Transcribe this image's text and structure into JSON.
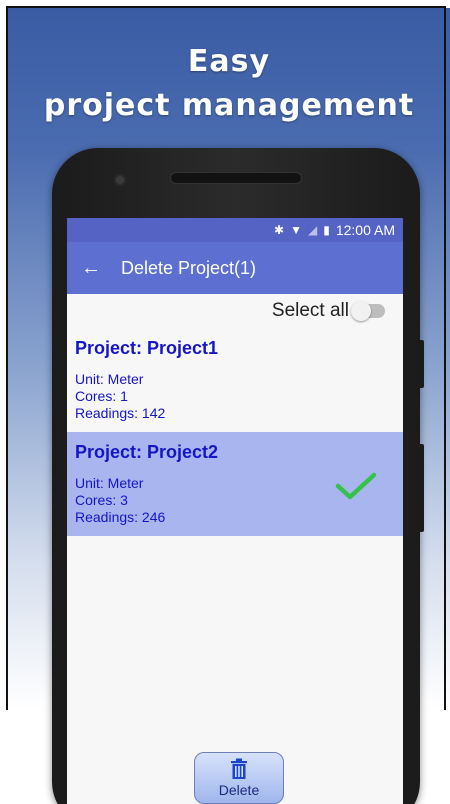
{
  "promo": {
    "line1": "Easy",
    "line2": "project management"
  },
  "statusbar": {
    "time": "12:00 AM",
    "icons": [
      "bluetooth-icon",
      "wifi-icon",
      "signal-icon",
      "battery-icon"
    ]
  },
  "appbar": {
    "title": "Delete Project(1)",
    "back_icon": "arrow-left-icon"
  },
  "select_all": {
    "label": "Select all",
    "checked": false
  },
  "projects": [
    {
      "name": "Project: Project1",
      "unit": "Unit: Meter",
      "cores": "Cores: 1",
      "readings": "Readings: 142",
      "selected": false
    },
    {
      "name": "Project: Project2",
      "unit": "Unit: Meter",
      "cores": "Cores: 3",
      "readings": "Readings: 246",
      "selected": true
    }
  ],
  "delete_button": {
    "label": "Delete",
    "icon": "trash-icon"
  },
  "colors": {
    "statusbar": "#5563c4",
    "appbar": "#5d6fd0",
    "selected_row": "#a9b5ef",
    "project_text": "#1515c8",
    "check": "#33c24a"
  }
}
